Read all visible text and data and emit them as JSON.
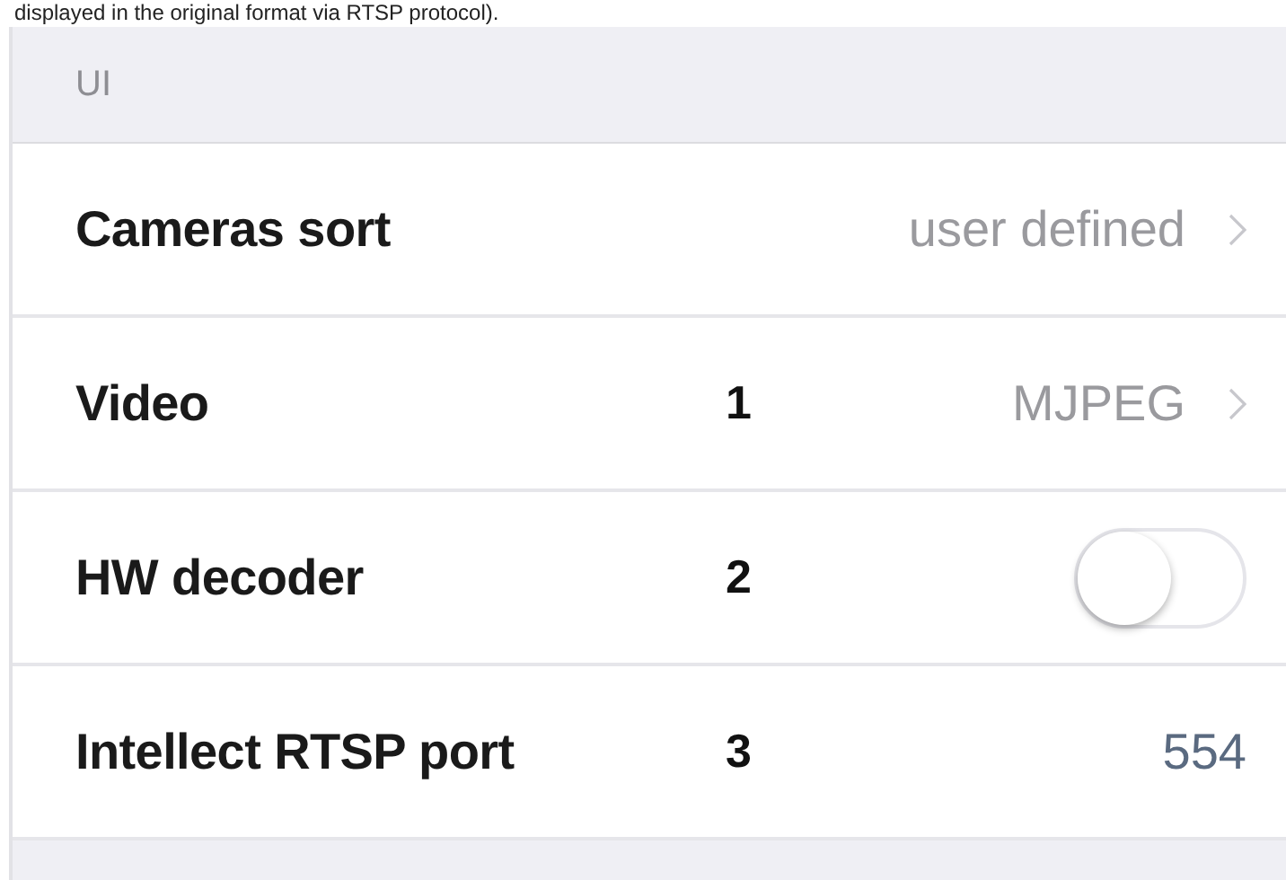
{
  "caption": "displayed in the original format via RTSP protocol).",
  "section": {
    "title": "UI"
  },
  "rows": [
    {
      "kind": "link",
      "label": "Cameras sort",
      "value": "user defined"
    },
    {
      "kind": "link",
      "label": "Video",
      "marker": "1",
      "value": "MJPEG"
    },
    {
      "kind": "toggle",
      "label": "HW decoder",
      "marker": "2",
      "on": false
    },
    {
      "kind": "number",
      "label": "Intellect RTSP port",
      "marker": "3",
      "value": "554"
    }
  ]
}
